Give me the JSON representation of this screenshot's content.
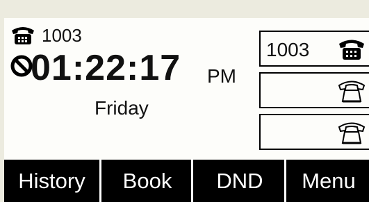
{
  "status": {
    "account_number": "1003",
    "time": "01:22:17",
    "ampm": "PM",
    "day": "Friday",
    "dnd_active_icon": "no-symbol-icon"
  },
  "line_keys": [
    {
      "label": "1003",
      "icon": "phone-filled-icon"
    },
    {
      "label": "",
      "icon": "phone-outline-icon"
    },
    {
      "label": "",
      "icon": "phone-outline-icon"
    }
  ],
  "softkeys": [
    {
      "label": "History"
    },
    {
      "label": "Book"
    },
    {
      "label": "DND"
    },
    {
      "label": "Menu"
    }
  ]
}
